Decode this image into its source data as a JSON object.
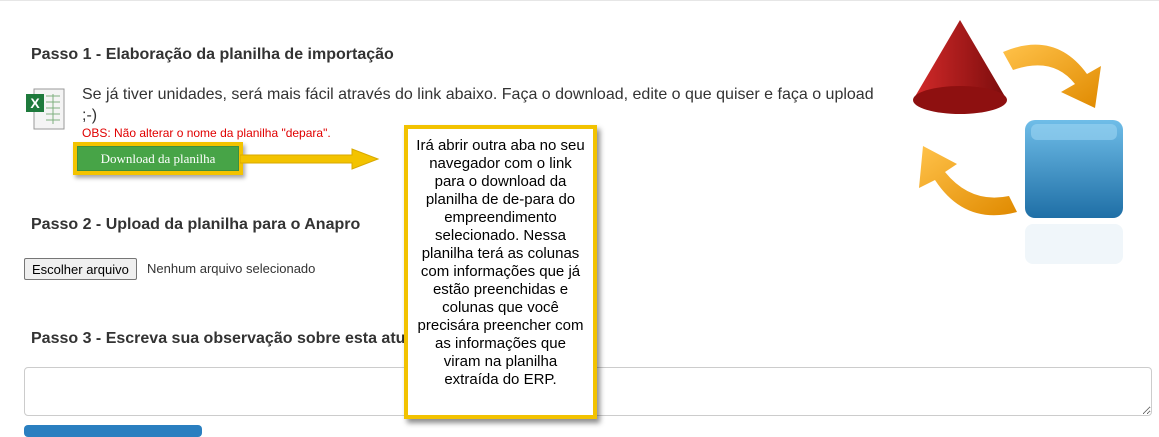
{
  "step1": {
    "title": "Passo 1 - Elaboração da planilha de importação",
    "intro": "Se já tiver unidades, será mais fácil através do link abaixo. Faça o download, edite o que quiser e faça o upload ;-)",
    "obs": "OBS: Não alterar o nome da planilha \"depara\".",
    "download_label": "Download da planilha",
    "icon": "excel-file-icon"
  },
  "callout": {
    "text": "Irá abrir outra aba no seu navegador com o link para o download da planilha de de-para do empreendimento selecionado. Nessa planilha terá as colunas com informações que já estão preenchidas e colunas que você precisára preencher com as informações que viram na planilha extraída do ERP."
  },
  "step2": {
    "title": "Passo 2 - Upload da planilha para o Anapro",
    "choose_file_label": "Escolher arquivo",
    "file_status": "Nenhum arquivo selecionado"
  },
  "step3": {
    "title": "Passo 3 - Escreva sua observação sobre esta atu"
  },
  "colors": {
    "download_button": "#47a447",
    "highlight": "#f3c300",
    "obs_text": "#e00000",
    "logo_cone": "#b01818",
    "logo_cube": "#3a8fc5",
    "logo_arrows": "#f0a000"
  }
}
